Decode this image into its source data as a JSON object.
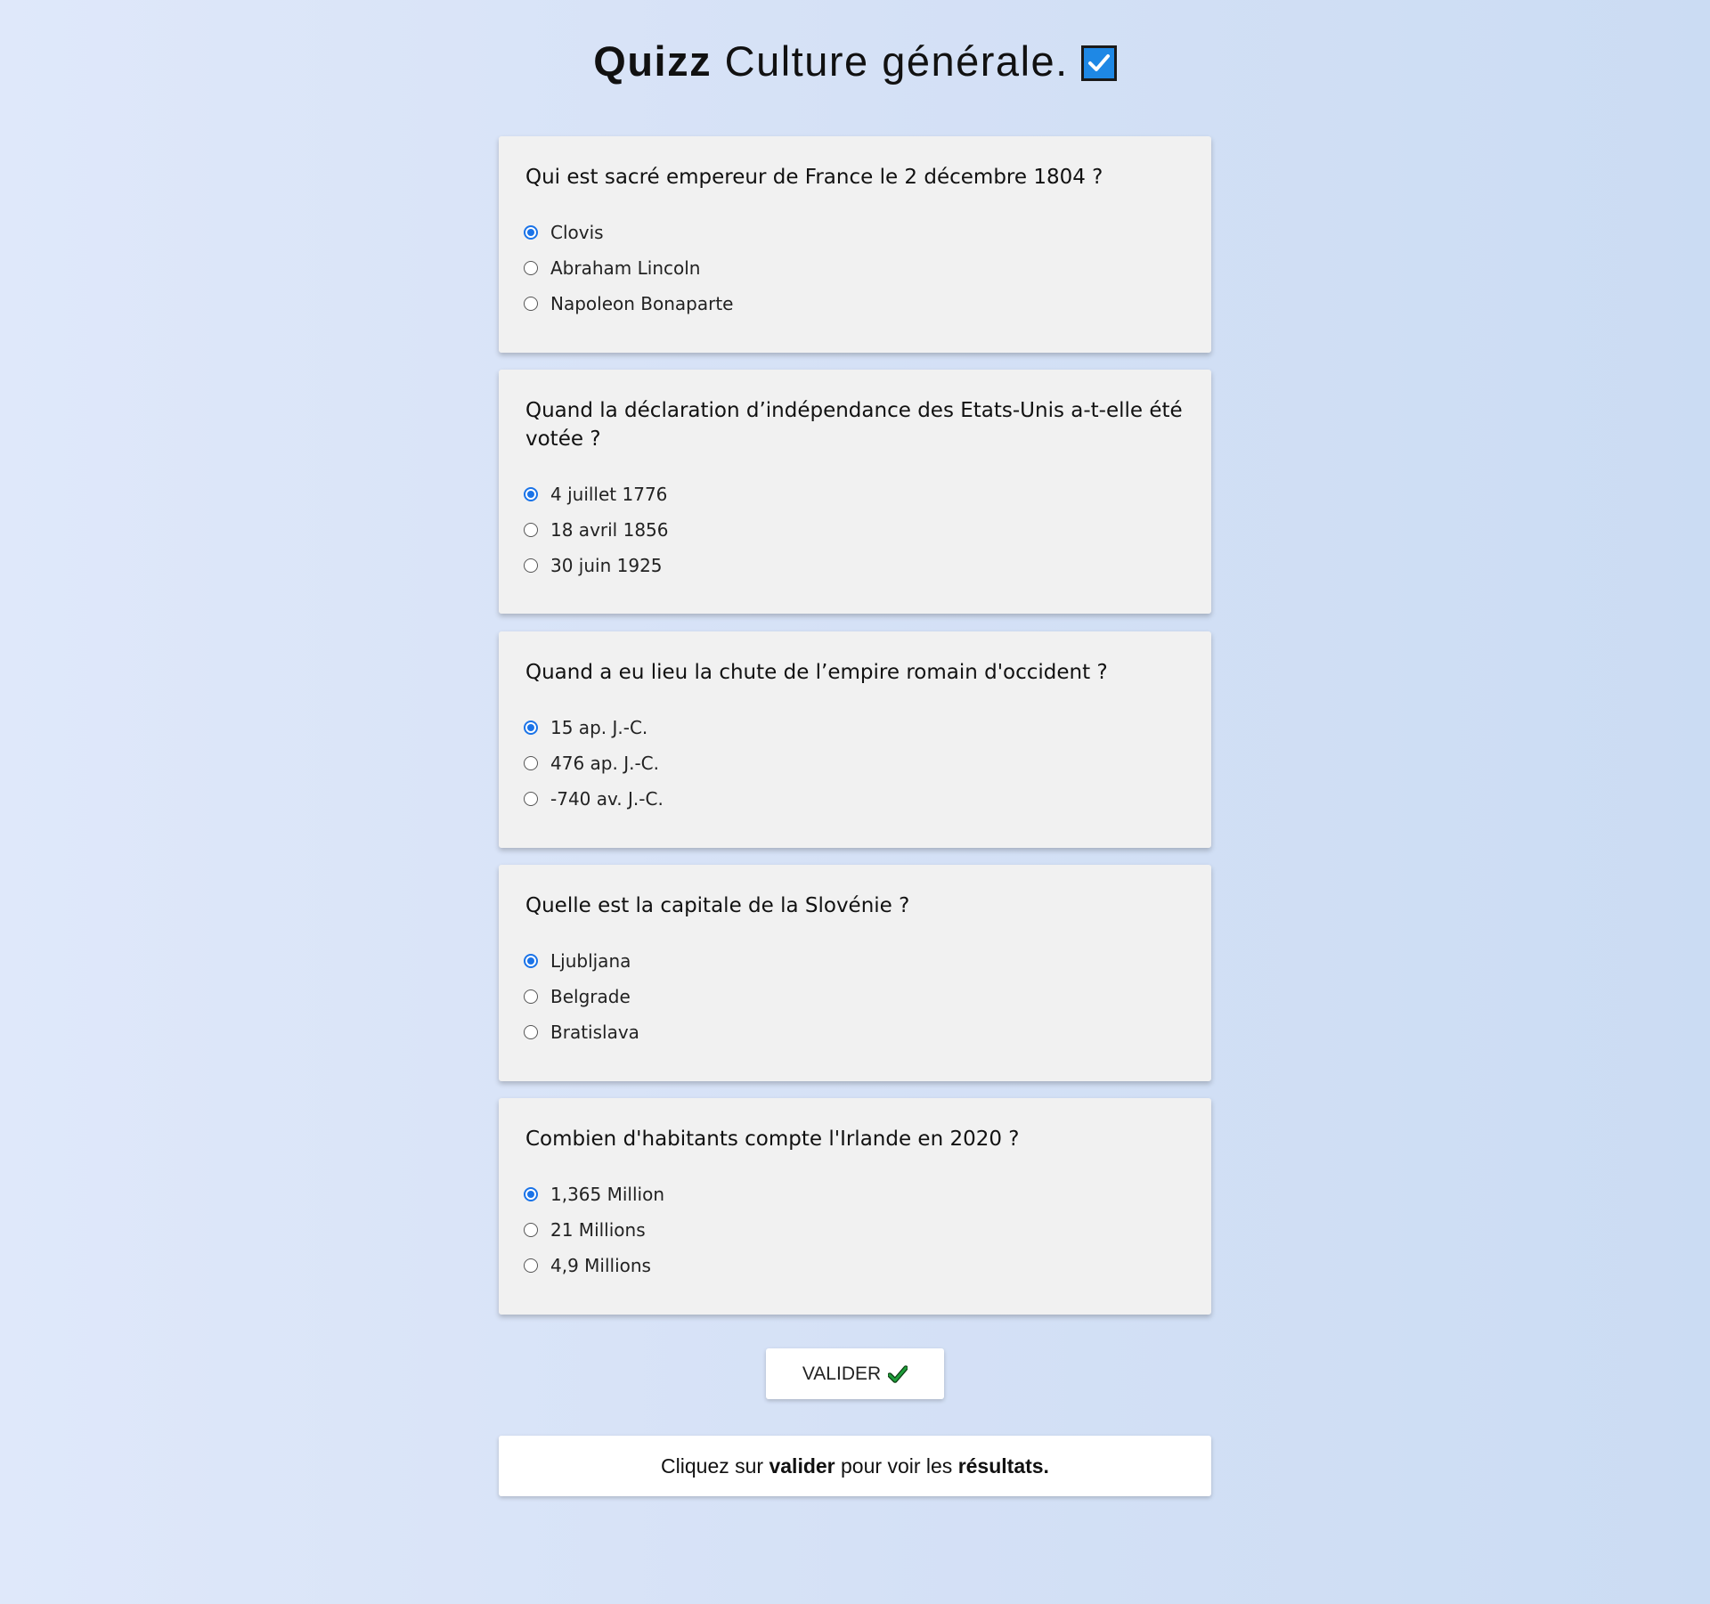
{
  "header": {
    "title_bold": "Quizz",
    "title_rest": " Culture générale.",
    "icon": "checkbox-checked-icon",
    "icon_color": "#1e88e5"
  },
  "questions": [
    {
      "text": "Qui est sacré empereur de France le 2 décembre 1804 ?",
      "options": [
        "Clovis",
        "Abraham Lincoln",
        "Napoleon Bonaparte"
      ],
      "selected": 0
    },
    {
      "text": "Quand la déclaration d’indépendance des Etats-Unis a-t-elle été votée ?",
      "options": [
        "4 juillet 1776",
        "18 avril 1856",
        "30 juin 1925"
      ],
      "selected": 0
    },
    {
      "text": "Quand a eu lieu la chute de l’empire romain d'occident ?",
      "options": [
        "15 ap. J.-C.",
        "476 ap. J.-C.",
        "-740 av. J.-C."
      ],
      "selected": 0
    },
    {
      "text": "Quelle est la capitale de la Slovénie ?",
      "options": [
        "Ljubljana",
        "Belgrade",
        "Bratislava"
      ],
      "selected": 0
    },
    {
      "text": "Combien d'habitants compte l'Irlande en 2020 ?",
      "options": [
        "1,365 Million",
        "21 Millions",
        "4,9 Millions"
      ],
      "selected": 0
    }
  ],
  "submit": {
    "label": "VALIDER",
    "icon": "checkmark-icon",
    "icon_color": "#1e9e3a"
  },
  "result": {
    "part1": "Cliquez sur ",
    "bold1": "valider",
    "part2": " pour voir les ",
    "bold2": "résultats."
  },
  "colors": {
    "radio_selected": "#1a73e8",
    "card_background": "#f1f1f1"
  }
}
